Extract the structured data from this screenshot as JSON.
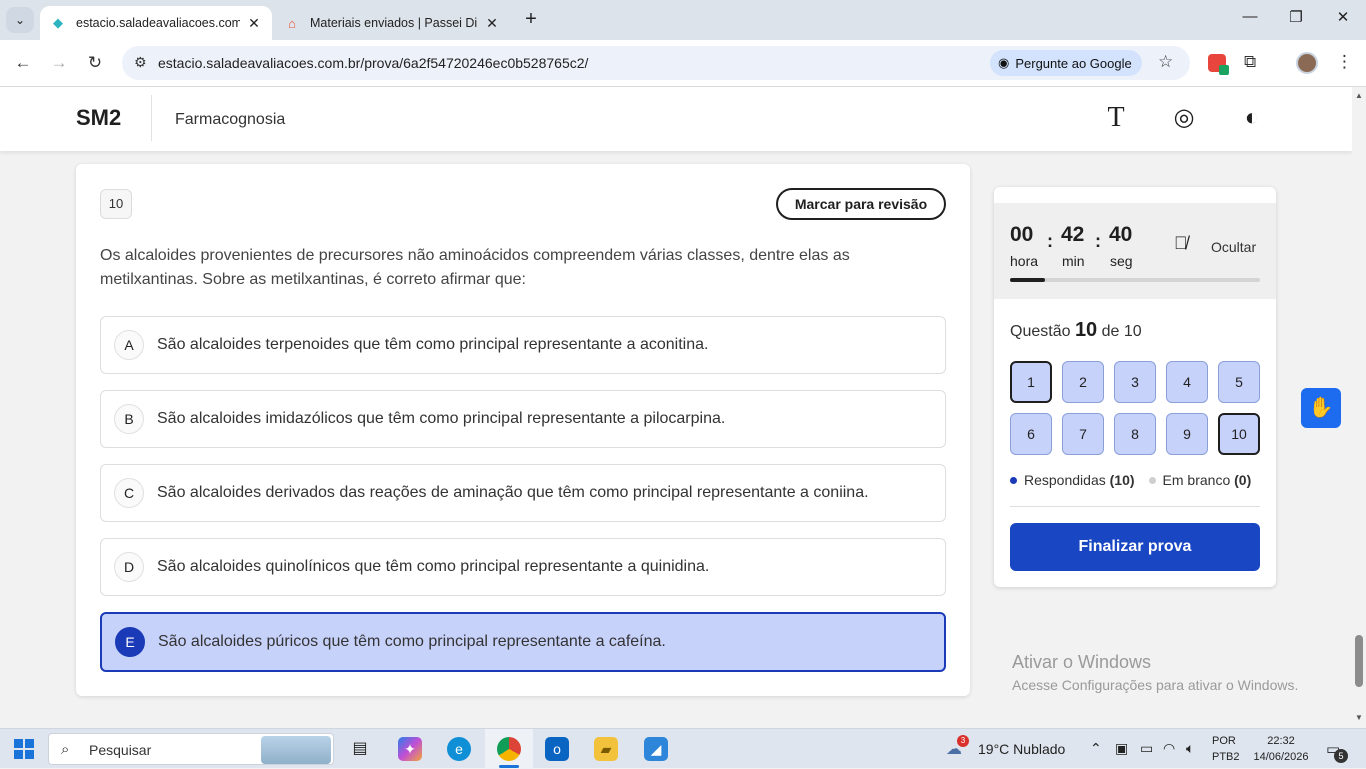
{
  "browser": {
    "tabs": [
      {
        "title": "estacio.saladeavaliacoes.com.br",
        "active": true
      },
      {
        "title": "Materiais enviados | Passei Direto",
        "active": false
      }
    ],
    "url": "estacio.saladeavaliacoes.com.br/prova/6a2f54720246ec0b528765c2/",
    "google_chip": "Pergunte ao Google"
  },
  "header": {
    "brand": "SM2",
    "course": "Farmacognosia",
    "icons": [
      "text-size-icon",
      "target-icon",
      "contrast-icon"
    ]
  },
  "question": {
    "number": "10",
    "review_label": "Marcar para revisão",
    "statement": "Os alcaloides provenientes de precursores não aminoácidos compreendem várias classes, dentre elas as metilxantinas. Sobre as metilxantinas, é correto afirmar que:",
    "options": [
      {
        "letter": "A",
        "text": "São alcaloides terpenoides que têm como principal representante a aconitina."
      },
      {
        "letter": "B",
        "text": "São alcaloides imidazólicos que têm como principal representante a pilocarpina."
      },
      {
        "letter": "C",
        "text": "São alcaloides derivados das reações de aminação que têm como principal representante a coniina."
      },
      {
        "letter": "D",
        "text": "São alcaloides quinolínicos que têm como principal representante a quinidina."
      },
      {
        "letter": "E",
        "text": "São alcaloides púricos que têm como principal representante a cafeína."
      }
    ],
    "selected": "E"
  },
  "timer": {
    "hours": "00",
    "minutes": "42",
    "seconds": "40",
    "hours_label": "hora",
    "minutes_label": "min",
    "seconds_label": "seg",
    "sep": ":",
    "hide_label": "Ocultar",
    "progress": 0.14
  },
  "nav": {
    "label_prefix": "Questão",
    "current": "10",
    "label_of": "de 10",
    "questions": [
      "1",
      "2",
      "3",
      "4",
      "5",
      "6",
      "7",
      "8",
      "9",
      "10"
    ],
    "answered_label": "Respondidas",
    "answered_count": "(10)",
    "blank_label": "Em branco",
    "blank_count": "(0)",
    "finish_label": "Finalizar prova"
  },
  "watermark": {
    "title": "Ativar o Windows",
    "subtitle": "Acesse Configurações para ativar o Windows."
  },
  "taskbar": {
    "search_placeholder": "Pesquisar",
    "weather_badge": "3",
    "weather": "19°C  Nublado",
    "lang_1": "POR",
    "lang_2": "PTB2",
    "time": "22:32",
    "date": "14/06/2026",
    "notification_count": "5"
  },
  "colors": {
    "accent": "#1946c3",
    "selected_bg": "#c7d2fb",
    "answered_dot": "#1a3ab8",
    "blank_dot": "#cfcfcf"
  }
}
